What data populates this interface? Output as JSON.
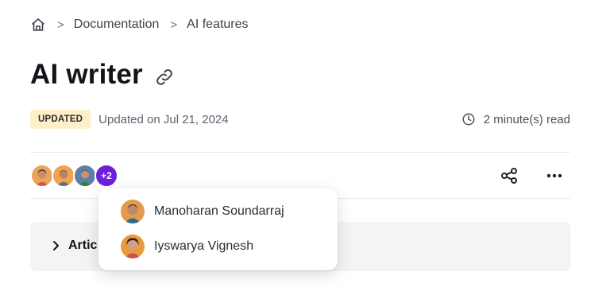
{
  "breadcrumb": {
    "home_icon": "home-icon",
    "items": [
      "Documentation",
      "AI features"
    ],
    "separator": ">"
  },
  "page": {
    "title": "AI writer",
    "link_icon": "link-icon"
  },
  "meta": {
    "badge": "UPDATED",
    "updated": "Updated on Jul 21, 2024",
    "read_time": "2 minute(s) read"
  },
  "contributors": {
    "more_count": "+2"
  },
  "popover": {
    "people": [
      "Manoharan Soundarraj",
      "Iyswarya Vignesh"
    ]
  },
  "article": {
    "toggle_label": "Artic"
  },
  "colors": {
    "badge_bg": "#fdf0c8",
    "more_badge": "#6d1fd9",
    "panel_bg": "#f4f4f5"
  }
}
